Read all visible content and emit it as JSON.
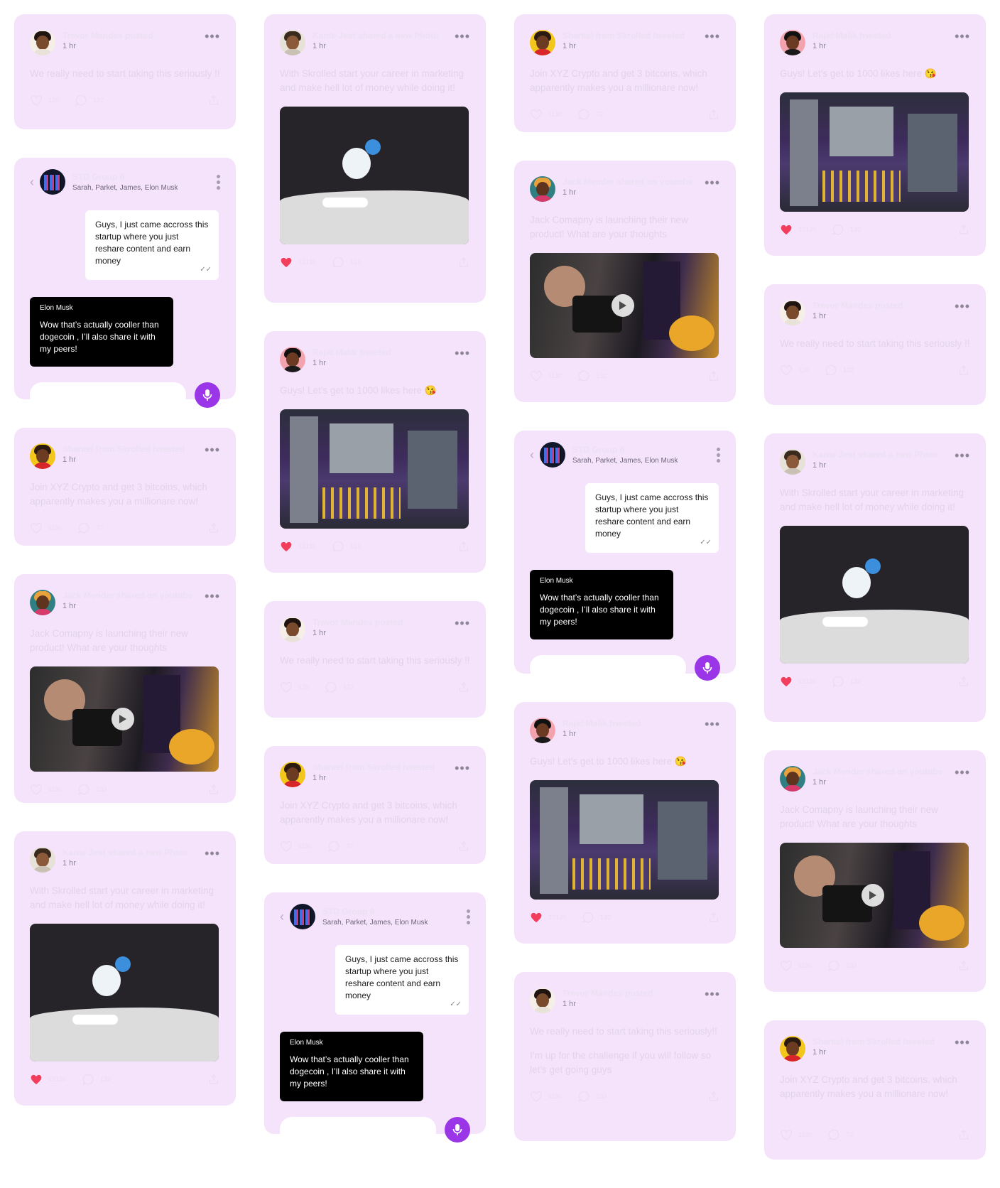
{
  "posts": {
    "trevor": {
      "title": "Trevor Mandes posted",
      "time": "1 hr",
      "text": "We really need to start taking this seriously !!",
      "likes": "120",
      "comments": "132"
    },
    "kante": {
      "title": "Kante Jest shared a new Photo",
      "time": "1 hr",
      "text": "With Skrolled start your career in marketing and make hell lot of money while doing it!",
      "likes": "12130",
      "comments": "132"
    },
    "shantel": {
      "title": "Shantel from Skrolled tweeted",
      "time": "1 hr",
      "text": "Join XYZ Crypto and get 3 bitcoins, which apparently makes you a millionare now!",
      "likes": "1130",
      "comments": "72"
    },
    "rajat": {
      "title": "Rajat Malik tweeted",
      "time": "1 hr",
      "text": "Guys! Let’s get to 1000 likes here 😘",
      "likes": "12130",
      "comments": "132"
    },
    "jack": {
      "title": "Jack Mender shared on youtube",
      "time": "1 hr",
      "text": "Jack Comapny is launching their new product! What are your thoughts",
      "likes": "1130",
      "comments": "132"
    },
    "trevor2": {
      "title": "Trevor Mandes posted",
      "time": "1 hr",
      "text": "We really need to start taking this seriously!!",
      "text2": "I’m up for the challenge if you will follow so let’s get going guys",
      "likes": "1130",
      "comments": "132"
    }
  },
  "chat": {
    "group": "STD Group 6",
    "members": "Sarah, Parket, James, Elon Musk",
    "incoming": "Guys, I just came accross this startup where you just reshare content and earn money",
    "sender": "Elon Musk",
    "outgoing": "Wow  that’s actually cooller than dogecoin , I’ll also share it with my peers!",
    "input_placeholder": ""
  },
  "icons": {
    "more": "more-horizontal-icon",
    "like": "heart-icon",
    "comment": "comment-icon",
    "share": "share-icon",
    "mic": "microphone-icon",
    "play": "play-icon",
    "back": "chevron-left-icon"
  },
  "colors": {
    "card": "#f4e3fb",
    "accent": "#9b36e8",
    "heart": "#f23e5c"
  }
}
